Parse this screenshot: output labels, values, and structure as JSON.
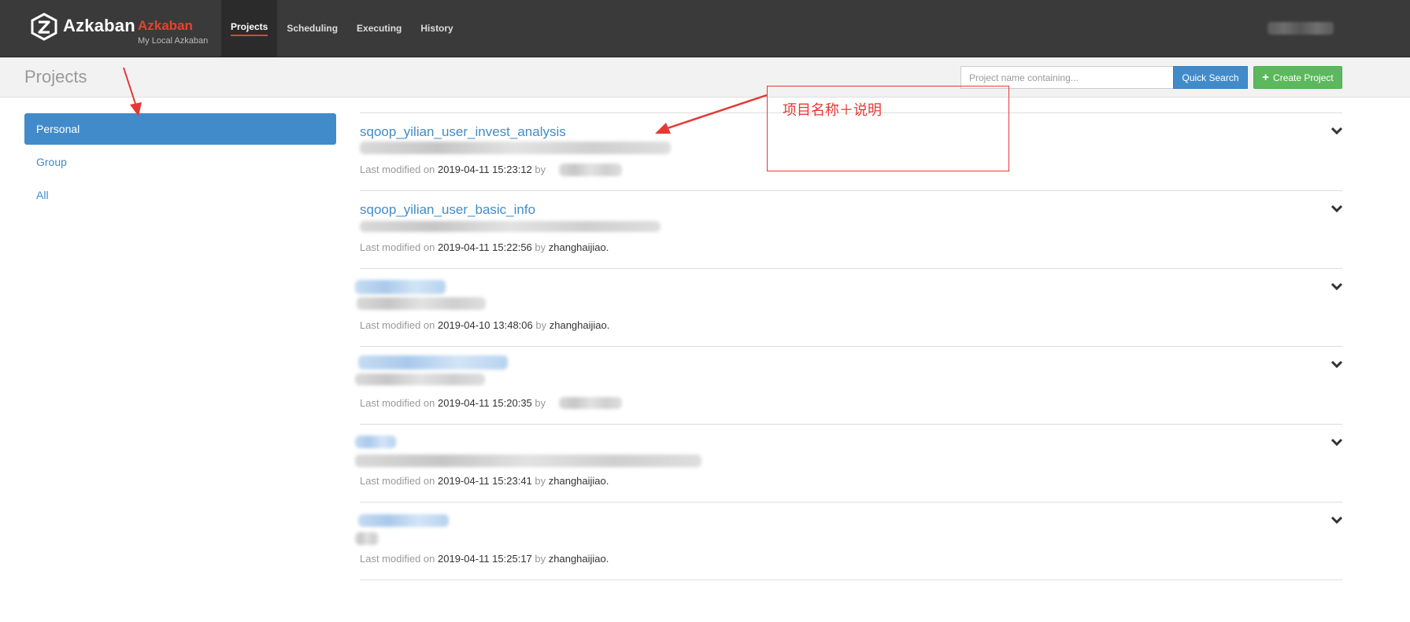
{
  "brand": {
    "name": "Azkaban",
    "env_name": "Azkaban",
    "env_desc": "My Local Azkaban"
  },
  "nav": [
    {
      "label": "Projects",
      "active": true
    },
    {
      "label": "Scheduling",
      "active": false
    },
    {
      "label": "Executing",
      "active": false
    },
    {
      "label": "History",
      "active": false
    }
  ],
  "header": {
    "title": "Projects",
    "search_placeholder": "Project name containing...",
    "quick_search_label": "Quick Search",
    "create_project_label": "Create Project"
  },
  "sidebar": {
    "items": [
      {
        "label": "Personal",
        "active": true
      },
      {
        "label": "Group",
        "active": false
      },
      {
        "label": "All",
        "active": false
      }
    ]
  },
  "projects": [
    {
      "name": "sqoop_yilian_user_invest_analysis",
      "modified_label": "Last modified on",
      "date": "2019-04-11 15:23:12",
      "by_label": "by",
      "user": ""
    },
    {
      "name": "sqoop_yilian_user_basic_info",
      "modified_label": "Last modified on",
      "date": "2019-04-11 15:22:56",
      "by_label": "by",
      "user": "zhanghaijiao."
    },
    {
      "name": "",
      "modified_label": "Last modified on",
      "date": "2019-04-10 13:48:06",
      "by_label": "by",
      "user": "zhanghaijiao."
    },
    {
      "name": "",
      "modified_label": "Last modified on",
      "date": "2019-04-11 15:20:35",
      "by_label": "by",
      "user": ""
    },
    {
      "name": "",
      "modified_label": "Last modified on",
      "date": "2019-04-11 15:23:41",
      "by_label": "by",
      "user": "zhanghaijiao."
    },
    {
      "name": "",
      "modified_label": "Last modified on",
      "date": "2019-04-11 15:25:17",
      "by_label": "by",
      "user": "zhanghaijiao."
    }
  ],
  "annotation": {
    "text": "项目名称＋说明",
    "color": "#e53935"
  },
  "colors": {
    "navbar": "#3a3a3a",
    "accent_red": "#e8412c",
    "link_blue": "#428bca",
    "create_green": "#5cb85c"
  }
}
